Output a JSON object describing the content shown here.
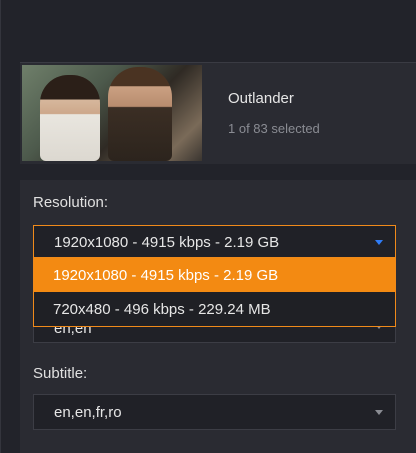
{
  "media": {
    "title": "Outlander",
    "selection_count": "1 of 83 selected",
    "thumbnail": "poster-thumbnail"
  },
  "settings": {
    "resolution": {
      "label": "Resolution:",
      "selected": "1920x1080 - 4915 kbps - 2.19 GB",
      "options": [
        "1920x1080 - 4915 kbps - 2.19 GB",
        "720x480 - 496 kbps - 229.24 MB"
      ]
    },
    "audio": {
      "selected": "en,en"
    },
    "subtitle": {
      "label": "Subtitle:",
      "selected": "en,en,fr,ro"
    }
  },
  "colors": {
    "accent_orange": "#f38a12",
    "caret_blue": "#2f7cf6",
    "background": "#22232a",
    "card": "#2a2b32"
  }
}
